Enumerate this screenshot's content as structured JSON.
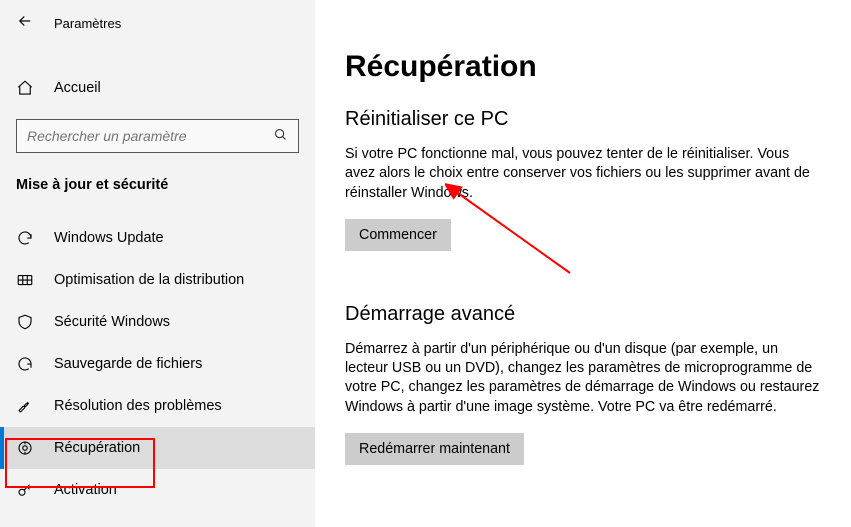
{
  "header": {
    "app_title": "Paramètres"
  },
  "home": {
    "label": "Accueil"
  },
  "search": {
    "placeholder": "Rechercher un paramètre"
  },
  "category": {
    "title": "Mise à jour et sécurité"
  },
  "nav": {
    "items": [
      {
        "label": "Windows Update"
      },
      {
        "label": "Optimisation de la distribution"
      },
      {
        "label": "Sécurité Windows"
      },
      {
        "label": "Sauvegarde de fichiers"
      },
      {
        "label": "Résolution des problèmes"
      },
      {
        "label": "Récupération"
      },
      {
        "label": "Activation"
      }
    ]
  },
  "main": {
    "page_title": "Récupération",
    "section1": {
      "heading": "Réinitialiser ce PC",
      "text": "Si votre PC fonctionne mal, vous pouvez tenter de le réinitialiser. Vous avez alors le choix entre conserver vos fichiers ou les supprimer avant de réinstaller Windows.",
      "button": "Commencer"
    },
    "section2": {
      "heading": "Démarrage avancé",
      "text": "Démarrez à partir d'un périphérique ou d'un disque (par exemple, un lecteur USB ou un DVD), changez les paramètres de microprogramme de votre PC, changez les paramètres de démarrage de Windows ou restaurez Windows à partir d'une image système. Votre PC va être redémarré.",
      "button": "Redémarrer maintenant"
    }
  }
}
